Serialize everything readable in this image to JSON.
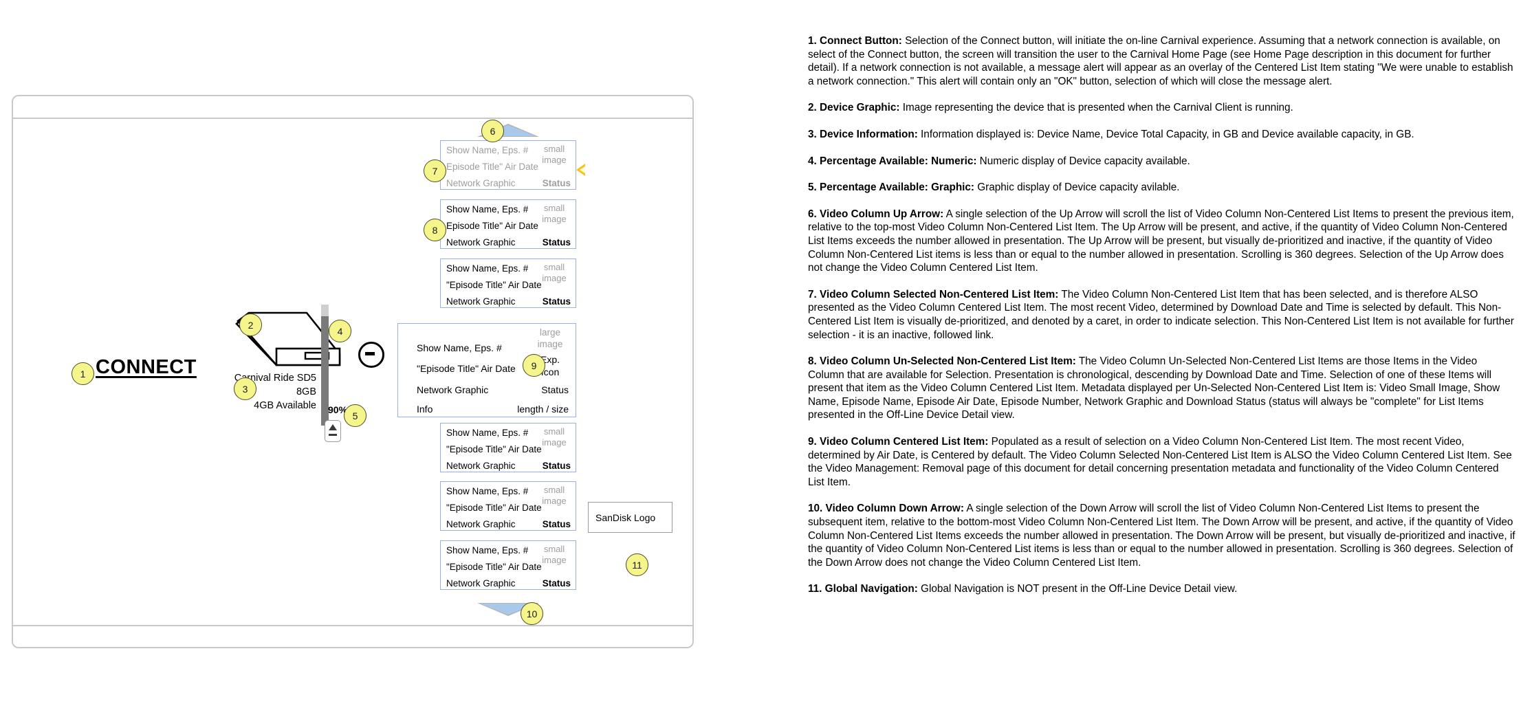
{
  "wireframe": {
    "connect_button": {
      "label": "CONNECT"
    },
    "device_info": {
      "name": "Carnival Ride SD5",
      "capacity": "8GB",
      "available": "4GB Available"
    },
    "capacity_percent": "90%",
    "icons": {
      "eject": "eject-icon",
      "remove": "minus-remove-icon",
      "up_arrow": "up-arrow-icon",
      "down_arrow": "down-arrow-icon",
      "caret": "caret-selected-icon",
      "device": "device-graphic-icon"
    },
    "list_item_template": {
      "title": "Show Name, Eps. #",
      "episode": "\"Episode Title\"  Air Date",
      "episode_selected": "Episode Title\"  Air Date",
      "network": "Network Graphic",
      "status": "Status",
      "image": "small\nimage",
      "image_line1": "small",
      "image_line2": "image"
    },
    "list_items_above": [
      {
        "title": "Show Name, Eps. #",
        "episode": "Episode Title\"  Air Date",
        "network": "Network Graphic",
        "status": "Status",
        "img1": "small",
        "img2": "image",
        "state": "selected-non-centered"
      },
      {
        "title": "Show Name, Eps. #",
        "episode": "Episode Title\"  Air Date",
        "network": "Network Graphic",
        "status": "Status",
        "img1": "small",
        "img2": "image",
        "state": "un-selected"
      },
      {
        "title": "Show Name, Eps. #",
        "episode": "\"Episode Title\"  Air Date",
        "network": "Network Graphic",
        "status": "Status",
        "img1": "small",
        "img2": "image",
        "state": "un-selected"
      }
    ],
    "centered_item": {
      "title": "Show Name, Eps. #",
      "episode": "\"Episode Title\"  Air Date",
      "network": "Network Graphic",
      "info": "Info",
      "image_line1": "large",
      "image_line2": "image",
      "exp_line1": "Exp.",
      "exp_line2": "Icon",
      "status": "Status",
      "length_size": "length / size"
    },
    "list_items_below": [
      {
        "title": "Show Name, Eps. #",
        "episode": "\"Episode Title\"  Air Date",
        "network": "Network Graphic",
        "status": "Status",
        "img1": "small",
        "img2": "image",
        "state": "un-selected"
      },
      {
        "title": "Show Name, Eps. #",
        "episode": "\"Episode Title\"  Air Date",
        "network": "Network Graphic",
        "status": "Status",
        "img1": "small",
        "img2": "image",
        "state": "un-selected"
      },
      {
        "title": "Show Name, Eps. #",
        "episode": "\"Episode Title\"  Air Date",
        "network": "Network Graphic",
        "status": "Status",
        "img1": "small",
        "img2": "image",
        "state": "un-selected"
      }
    ],
    "logo_box": {
      "label": "SanDisk Logo"
    },
    "callouts": [
      "1",
      "2",
      "3",
      "4",
      "5",
      "6",
      "7",
      "8",
      "9",
      "10",
      "11"
    ]
  },
  "spec": {
    "items": [
      {
        "num": "1.",
        "title": "Connect Button:",
        "body": " Selection of the Connect button, will initiate the on-line Carnival experience. Assuming that a network connection is available, on select of the Connect button, the screen will transition the user to the Carnival Home Page (see Home Page description in this document for further detail). If a network connection is not available, a message alert will appear as an overlay of the Centered List Item stating \"We were unable to establish a network connection.\" This alert will contain only an \"OK\" button, selection of which will close the message alert."
      },
      {
        "num": "2.",
        "title": "Device Graphic:",
        "body": " Image representing the device that is presented when the Carnival Client is running."
      },
      {
        "num": "3.",
        "title": "Device Information:",
        "body": " Information displayed is: Device Name, Device Total Capacity, in GB and Device available capacity, in GB."
      },
      {
        "num": "4.",
        "title": "Percentage Available: Numeric:",
        "body": " Numeric display of Device capacity available."
      },
      {
        "num": "5.",
        "title": "Percentage Available: Graphic:",
        "body": " Graphic display of Device capacity avilable."
      },
      {
        "num": "6.",
        "title": "Video Column Up Arrow:",
        "body": " A single selection of the Up Arrow will scroll the list of Video Column Non-Centered List Items to present the previous item, relative to the top-most Video Column Non-Centered List Item. The Up Arrow will be present, and active, if the quantity of Video Column Non-Centered List Items exceeds the number allowed in presentation. The Up Arrow will be present, but visually de-prioritized and inactive, if the quantity of Video Column Non-Centered List items is less than or equal to the number allowed in presentation. Scrolling is 360 degrees. Selection of the Up Arrow does not change the Video Column Centered List Item."
      },
      {
        "num": "7.",
        "title": "Video Column Selected Non-Centered List Item:",
        "body": " The Video Column Non-Centered List Item that has been selected, and is therefore ALSO presented as the Video Column Centered List Item. The most recent Video, determined by Download Date and Time is selected by default. This Non-Centered List Item is visually de-prioritized, and denoted by a caret, in order to indicate selection. This Non-Centered List Item is not available for further selection - it is an inactive, followed link."
      },
      {
        "num": "8.",
        "title": "Video Column Un-Selected Non-Centered List Item:",
        "body": " The Video Column Un-Selected Non-Centered List Items are those Items in the Video Column that are available for Selection. Presentation is chronological, descending by Download Date and Time. Selection of one of these Items will present that item as the Video Column Centered List Item. Metadata displayed per Un-Selected Non-Centered List Item is: Video Small Image, Show Name, Episode Name, Episode Air Date, Episode Number, Network Graphic and Download Status (status will always be \"complete\" for List Items presented in the Off-Line Device Detail view."
      },
      {
        "num": "9.",
        "title": "Video Column Centered List Item:",
        "body": " Populated as a result of selection on a Video Column Non-Centered List Item. The most recent Video, determined by Air Date, is Centered by default. The Video Column Selected Non-Centered List Item is ALSO the Video Column Centered List Item. See the Video Management: Removal page of this document for detail concerning presentation metadata and functionality of the Video Column Centered List Item."
      },
      {
        "num": "10.",
        "title": "Video Column Down Arrow:",
        "body": " A single selection of the Down Arrow will scroll the list of Video Column Non-Centered List Items to present the subsequent item, relative to the bottom-most Video Column Non-Centered List Item. The Down Arrow will be present, and active, if the quantity of Video Column Non-Centered List Items exceeds the number allowed in presentation. The Down Arrow will be present, but visually de-prioritized and inactive, if the quantity of Video Column Non-Centered List items is less than or equal to the number allowed in presentation. Scrolling is 360 degrees. Selection of the Down Arrow does not change the Video Column Centered List Item."
      },
      {
        "num": "11.",
        "title": "Global Navigation:",
        "body": " Global Navigation is NOT present in the Off-Line Device Detail view."
      }
    ]
  },
  "colors": {
    "callout_fill": "#f5f58c",
    "list_border": "#9aaee8",
    "arrow_blue": "#a8c8ec",
    "arrow_gray": "#b5b5b5",
    "frame_gray": "#c9c9c9",
    "muted_text": "#9e9e9e",
    "caret_yellow": "#f5c518"
  }
}
